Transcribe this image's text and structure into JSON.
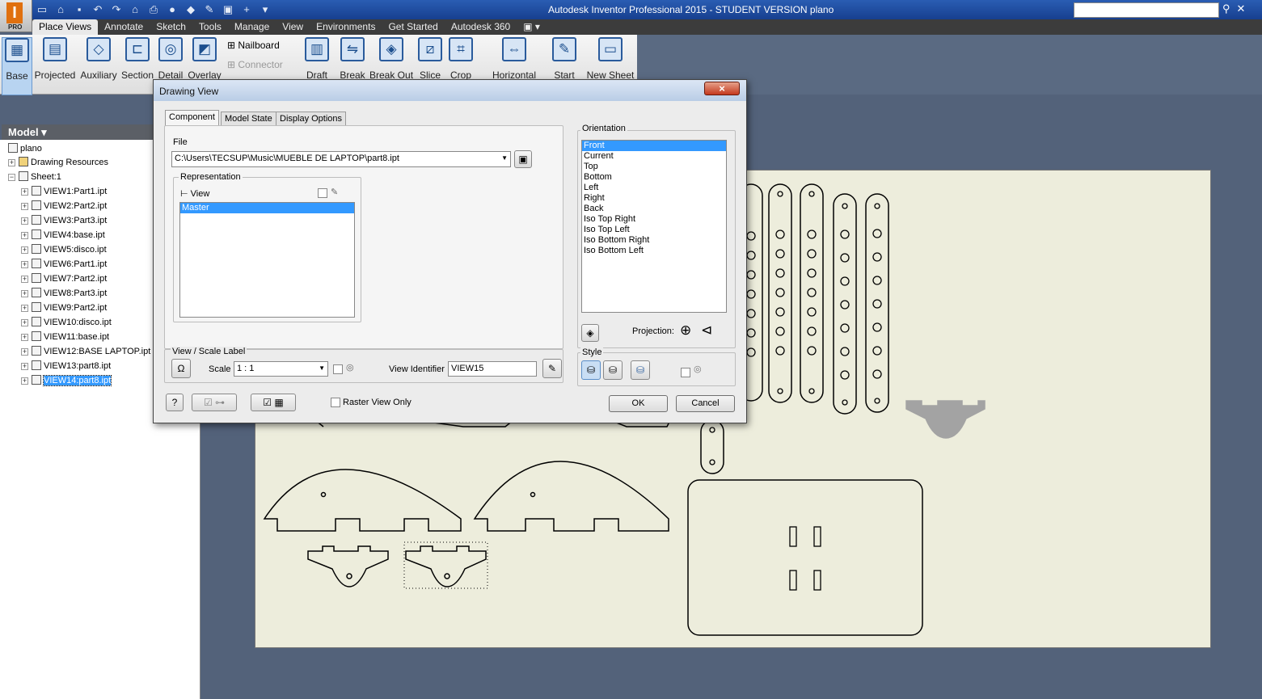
{
  "app": {
    "title": "Autodesk Inventor Professional 2015 - STUDENT VERSION    plano",
    "logo_badge": "PRO",
    "qat_icons": [
      "new-icon",
      "open-icon",
      "save-icon",
      "undo-icon",
      "redo-icon",
      "home-icon",
      "print-icon",
      "dropdown-icon",
      "material-icon",
      "appearance-icon",
      "update-icon",
      "add-icon",
      "more-icon"
    ]
  },
  "menu": {
    "tabs": [
      "Place Views",
      "Annotate",
      "Sketch",
      "Tools",
      "Manage",
      "View",
      "Environments",
      "Get Started",
      "Autodesk 360"
    ]
  },
  "ribbon": {
    "create": [
      "Base",
      "Projected",
      "Auxiliary",
      "Section",
      "Detail",
      "Overlay"
    ],
    "nailboard": "Nailboard",
    "connector": "Connector",
    "modify": [
      "Draft",
      "Break",
      "Break Out",
      "Slice",
      "Crop"
    ],
    "horizontal": "Horizontal",
    "start": "Start",
    "new_sheet": "New Sheet"
  },
  "browser": {
    "header": "Model",
    "root": "plano",
    "resources": "Drawing Resources",
    "sheet": "Sheet:1",
    "views": [
      "VIEW1:Part1.ipt",
      "VIEW2:Part2.ipt",
      "VIEW3:Part3.ipt",
      "VIEW4:base.ipt",
      "VIEW5:disco.ipt",
      "VIEW6:Part1.ipt",
      "VIEW7:Part2.ipt",
      "VIEW8:Part3.ipt",
      "VIEW9:Part2.ipt",
      "VIEW10:disco.ipt",
      "VIEW11:base.ipt",
      "VIEW12:BASE LAPTOP.ipt",
      "VIEW13:part8.ipt",
      "VIEW14:part8.ipt"
    ],
    "selected_index": 13
  },
  "dialog": {
    "title": "Drawing View",
    "close": "×",
    "tabs": [
      "Component",
      "Model State",
      "Display Options"
    ],
    "file_label": "File",
    "file_value": "C:\\Users\\TECSUP\\Music\\MUEBLE DE LAPTOP\\part8.ipt",
    "representation_label": "Representation",
    "view_label": "View",
    "rep_items": [
      "Master"
    ],
    "orientation_label": "Orientation",
    "orientations": [
      "Front",
      "Current",
      "Top",
      "Bottom",
      "Left",
      "Right",
      "Back",
      "Iso Top Right",
      "Iso Top Left",
      "Iso Bottom Right",
      "Iso Bottom Left"
    ],
    "projection_label": "Projection:",
    "view_scale_label": "View / Scale Label",
    "scale_label": "Scale",
    "scale_value": "1 : 1",
    "view_identifier_label": "View Identifier",
    "view_identifier_value": "VIEW15",
    "style_label": "Style",
    "raster_label": "Raster View Only",
    "ok": "OK",
    "cancel": "Cancel"
  }
}
